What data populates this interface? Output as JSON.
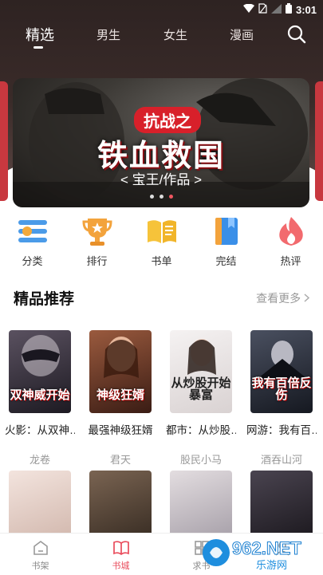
{
  "status_bar": {
    "time": "3:01"
  },
  "top_tabs": [
    {
      "label": "精选",
      "active": true
    },
    {
      "label": "男生"
    },
    {
      "label": "女生"
    },
    {
      "label": "漫画"
    }
  ],
  "banner": {
    "badge": "抗战之",
    "title": "铁血救国",
    "subtitle": "< 宝王/作品 >",
    "page_count": 3,
    "active_page": 3
  },
  "categories": [
    {
      "label": "分类",
      "icon": "category-icon"
    },
    {
      "label": "排行",
      "icon": "trophy-icon"
    },
    {
      "label": "书单",
      "icon": "open-book-icon"
    },
    {
      "label": "完结",
      "icon": "bookmark-book-icon"
    },
    {
      "label": "热评",
      "icon": "flame-icon"
    }
  ],
  "section": {
    "title": "精品推荐",
    "more": "查看更多"
  },
  "books_row1": [
    {
      "title": "火影：从双神…",
      "author": "龙卷",
      "cover_text": "双神威开始",
      "cover_color": "#3a3340"
    },
    {
      "title": "最强神级狂婿",
      "author": "君天",
      "cover_text": "神级狂婿",
      "cover_color": "#6b3a2c"
    },
    {
      "title": "都市：从炒股…",
      "author": "股民小马",
      "cover_text": "从炒股开始暴富",
      "cover_color": "#eae6e6"
    },
    {
      "title": "网游：我有百…",
      "author": "酒吞山河",
      "cover_text": "我有百倍反伤",
      "cover_color": "#2a2f3c"
    }
  ],
  "books_row2": [
    {
      "cover_color": "#e8d8d2"
    },
    {
      "cover_color": "#5a4a3e"
    },
    {
      "cover_color": "#cfc8cc"
    },
    {
      "cover_color": "#2e2a30"
    }
  ],
  "bottom_nav": [
    {
      "label": "书架",
      "icon": "shelf-icon"
    },
    {
      "label": "书城",
      "icon": "book-city-icon",
      "active": true
    },
    {
      "label": "求书",
      "icon": "grid-icon"
    },
    {
      "label": "",
      "icon": "profile-icon"
    }
  ],
  "watermark": {
    "brand": "962.NET",
    "text": "乐游网"
  },
  "colors": {
    "accent": "#e94b5b",
    "hero": "#3a2b29"
  }
}
